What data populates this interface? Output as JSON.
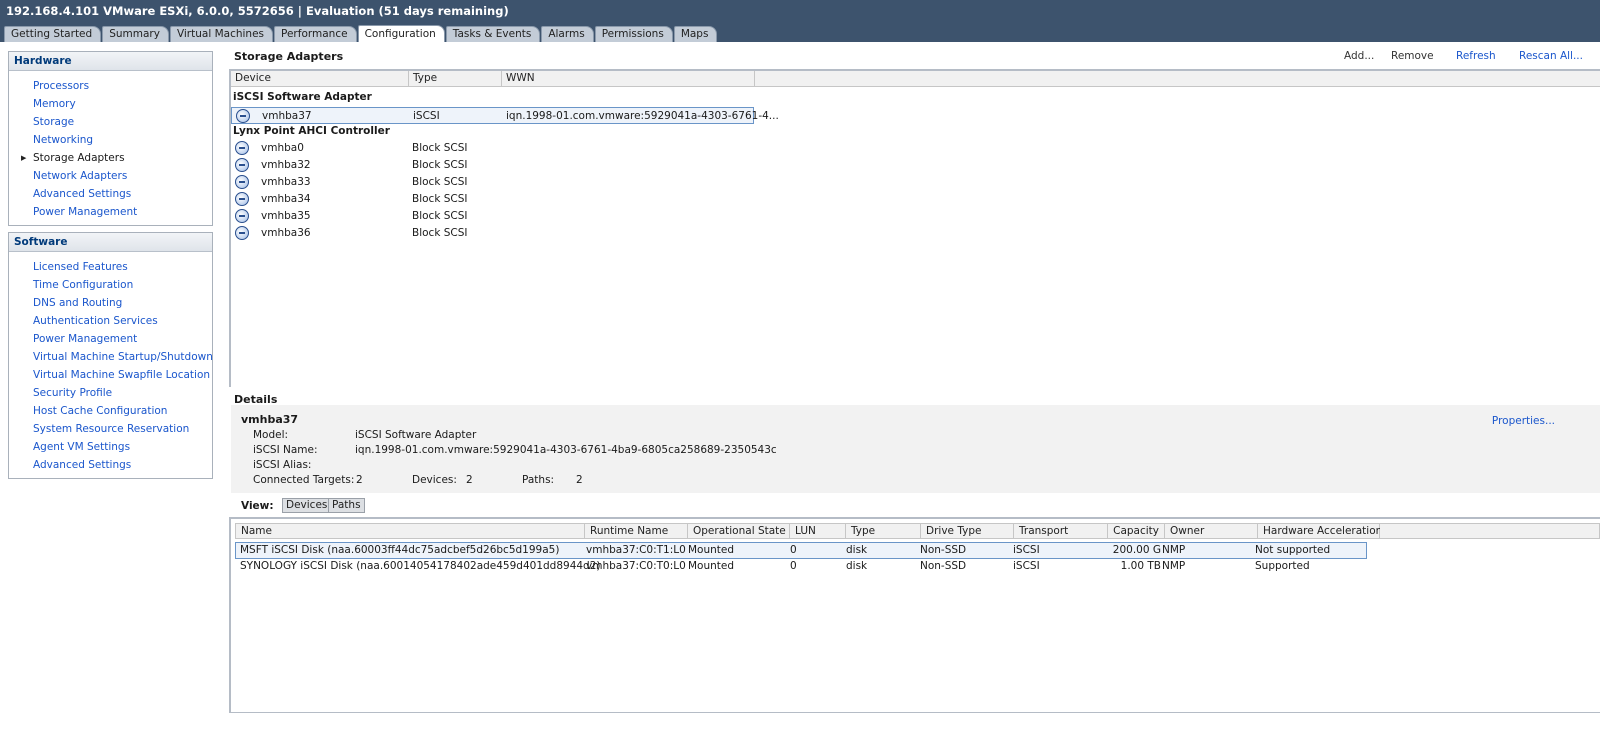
{
  "window": {
    "title": "192.168.4.101 VMware ESXi, 6.0.0, 5572656 | Evaluation (51 days remaining)"
  },
  "tabs": [
    {
      "label": "Getting Started",
      "active": false
    },
    {
      "label": "Summary",
      "active": false
    },
    {
      "label": "Virtual Machines",
      "active": false
    },
    {
      "label": "Performance",
      "active": false
    },
    {
      "label": "Configuration",
      "active": true
    },
    {
      "label": "Tasks & Events",
      "active": false
    },
    {
      "label": "Alarms",
      "active": false
    },
    {
      "label": "Permissions",
      "active": false
    },
    {
      "label": "Maps",
      "active": false
    }
  ],
  "sidebar": {
    "hardware": {
      "title": "Hardware",
      "items": [
        {
          "label": "Processors",
          "active": false
        },
        {
          "label": "Memory",
          "active": false
        },
        {
          "label": "Storage",
          "active": false
        },
        {
          "label": "Networking",
          "active": false
        },
        {
          "label": "Storage Adapters",
          "active": true
        },
        {
          "label": "Network Adapters",
          "active": false
        },
        {
          "label": "Advanced Settings",
          "active": false
        },
        {
          "label": "Power Management",
          "active": false
        }
      ]
    },
    "software": {
      "title": "Software",
      "items": [
        {
          "label": "Licensed Features"
        },
        {
          "label": "Time Configuration"
        },
        {
          "label": "DNS and Routing"
        },
        {
          "label": "Authentication Services"
        },
        {
          "label": "Power Management"
        },
        {
          "label": "Virtual Machine Startup/Shutdown"
        },
        {
          "label": "Virtual Machine Swapfile Location"
        },
        {
          "label": "Security Profile"
        },
        {
          "label": "Host Cache Configuration"
        },
        {
          "label": "System Resource Reservation"
        },
        {
          "label": "Agent VM Settings"
        },
        {
          "label": "Advanced Settings"
        }
      ]
    }
  },
  "storage_adapters": {
    "title": "Storage Adapters",
    "toolbar": {
      "add": "Add...",
      "remove": "Remove",
      "refresh": "Refresh",
      "rescan": "Rescan All..."
    },
    "columns": [
      "Device",
      "Type",
      "WWN"
    ],
    "groups": [
      {
        "name": "iSCSI Software Adapter",
        "rows": [
          {
            "device": "vmhba37",
            "type": "iSCSI",
            "wwn": "iqn.1998-01.com.vmware:5929041a-4303-6761-4...",
            "selected": true
          }
        ]
      },
      {
        "name": "Lynx Point AHCI Controller",
        "rows": [
          {
            "device": "vmhba0",
            "type": "Block SCSI",
            "wwn": ""
          },
          {
            "device": "vmhba32",
            "type": "Block SCSI",
            "wwn": ""
          },
          {
            "device": "vmhba33",
            "type": "Block SCSI",
            "wwn": ""
          },
          {
            "device": "vmhba34",
            "type": "Block SCSI",
            "wwn": ""
          },
          {
            "device": "vmhba35",
            "type": "Block SCSI",
            "wwn": ""
          },
          {
            "device": "vmhba36",
            "type": "Block SCSI",
            "wwn": ""
          }
        ]
      }
    ]
  },
  "details": {
    "title": "Details",
    "name": "vmhba37",
    "properties_link": "Properties...",
    "model_label": "Model:",
    "model_value": "iSCSI Software Adapter",
    "iscsi_name_label": "iSCSI Name:",
    "iscsi_name_value": "iqn.1998-01.com.vmware:5929041a-4303-6761-4ba9-6805ca258689-2350543c",
    "iscsi_alias_label": "iSCSI Alias:",
    "iscsi_alias_value": "",
    "connected_targets_label": "Connected Targets:",
    "connected_targets_value": "2",
    "devices_label": "Devices:",
    "devices_value": "2",
    "paths_label": "Paths:",
    "paths_value": "2",
    "view_label": "View:",
    "view_devices": "Devices",
    "view_paths": "Paths"
  },
  "devices_table": {
    "columns": [
      "Name",
      "Runtime Name",
      "Operational State",
      "LUN",
      "Type",
      "Drive Type",
      "Transport",
      "Capacity",
      "Owner",
      "Hardware Acceleration"
    ],
    "rows": [
      {
        "name": "MSFT iSCSI Disk (naa.60003ff44dc75adcbef5d26bc5d199a5)",
        "runtime": "vmhba37:C0:T1:L0",
        "state": "Mounted",
        "lun": "0",
        "type": "disk",
        "drive_type": "Non-SSD",
        "transport": "iSCSI",
        "capacity": "200.00 G",
        "owner": "NMP",
        "hw_accel": "Not supported",
        "selected": true
      },
      {
        "name": "SYNOLOGY iSCSI Disk (naa.60014054178402ade459d401dd8944d2)",
        "runtime": "vmhba37:C0:T0:L0",
        "state": "Mounted",
        "lun": "0",
        "type": "disk",
        "drive_type": "Non-SSD",
        "transport": "iSCSI",
        "capacity": "1.00 TB",
        "owner": "NMP",
        "hw_accel": "Supported",
        "selected": false
      }
    ]
  }
}
